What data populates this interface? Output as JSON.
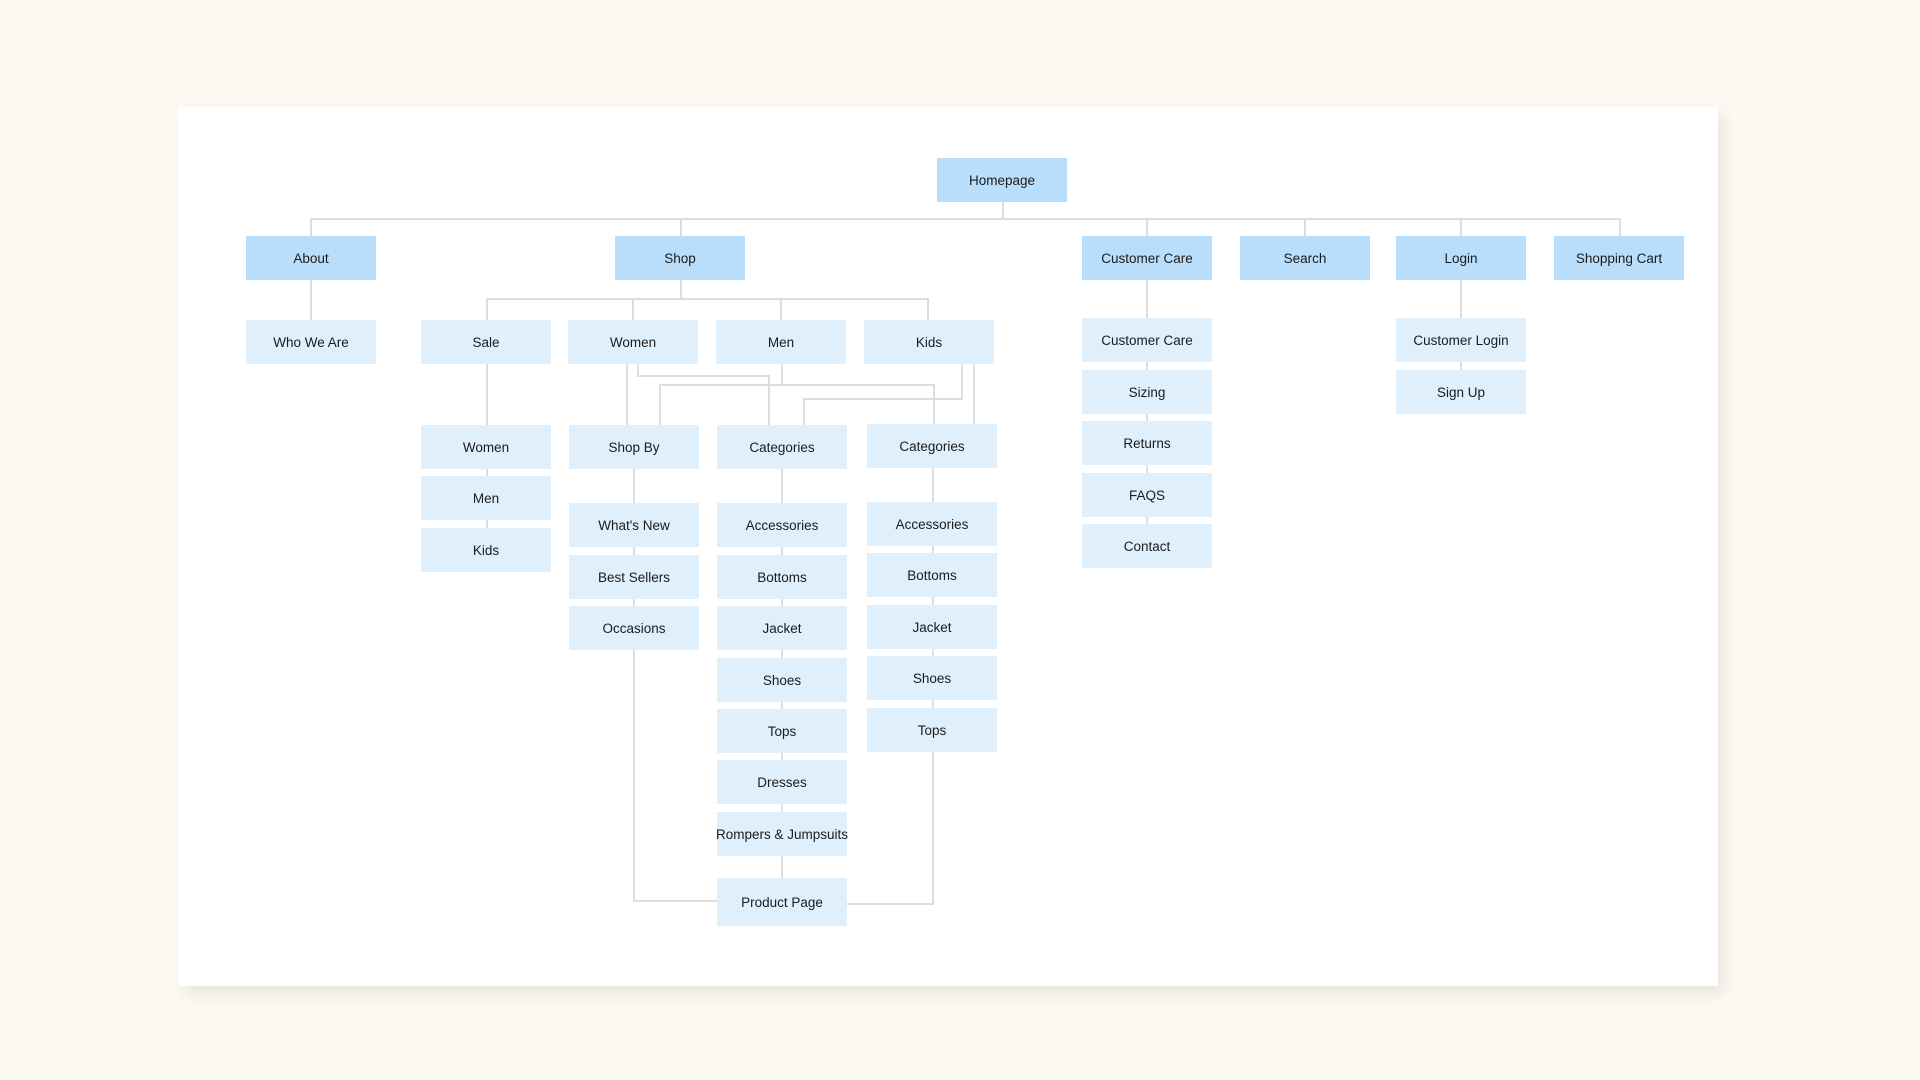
{
  "colors": {
    "parent": "#b9defc",
    "child": "#e0effc",
    "connector": "#dedede",
    "background": "#fdf8f2"
  },
  "root": "Homepage",
  "level1": [
    "About",
    "Shop",
    "Customer Care",
    "Search",
    "Login",
    "Shopping Cart"
  ],
  "about": {
    "children": [
      "Who We Are"
    ]
  },
  "shop": {
    "sections": [
      "Sale",
      "Women",
      "Men",
      "Kids"
    ],
    "sale_children": [
      "Women",
      "Men",
      "Kids"
    ],
    "shop_by": {
      "label": "Shop By",
      "children": [
        "What's New",
        "Best Sellers",
        "Occasions"
      ]
    },
    "categories_main": {
      "label": "Categories",
      "children": [
        "Accessories",
        "Bottoms",
        "Jacket",
        "Shoes",
        "Tops",
        "Dresses",
        "Rompers & Jumpsuits"
      ]
    },
    "categories_kids": {
      "label": "Categories",
      "children": [
        "Accessories",
        "Bottoms",
        "Jacket",
        "Shoes",
        "Tops"
      ]
    },
    "product_page": "Product Page"
  },
  "customer_care": {
    "children": [
      "Customer Care",
      "Sizing",
      "Returns",
      "FAQS",
      "Contact"
    ]
  },
  "login": {
    "children": [
      "Customer Login",
      "Sign Up"
    ]
  }
}
